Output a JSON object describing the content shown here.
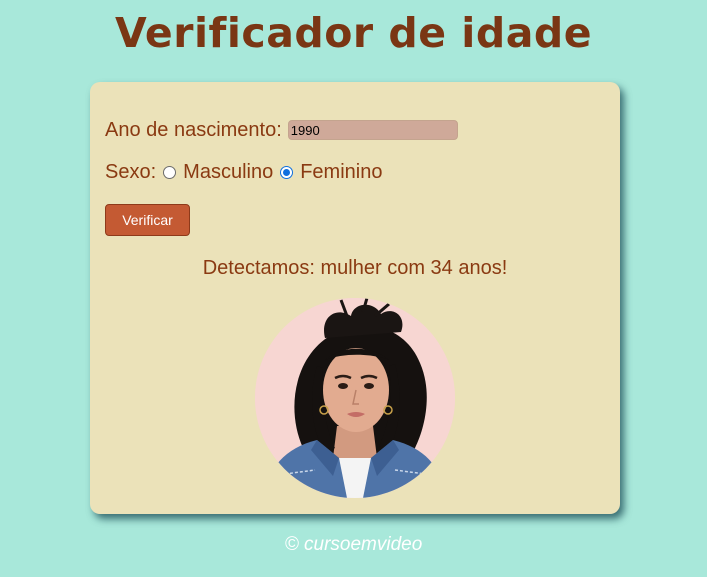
{
  "page": {
    "title": "Verificador de idade",
    "footer": "© cursoemvideo"
  },
  "form": {
    "year_label": "Ano de nascimento:",
    "year_value": "1990",
    "sex_label": "Sexo:",
    "options": [
      {
        "label": "Masculino",
        "checked": false
      },
      {
        "label": "Feminino",
        "checked": true
      }
    ],
    "button_label": "Verificar"
  },
  "result": {
    "text": "Detectamos: mulher com 34 anos!"
  },
  "colors": {
    "background": "#a8e8da",
    "card": "#ebe2b9",
    "title": "#7a3614",
    "text": "#8a3a12",
    "button": "#c45a33",
    "input": "#cfa999",
    "radio_checked": "#0f6fde"
  },
  "image": {
    "subject": "woman-portrait-photo"
  }
}
